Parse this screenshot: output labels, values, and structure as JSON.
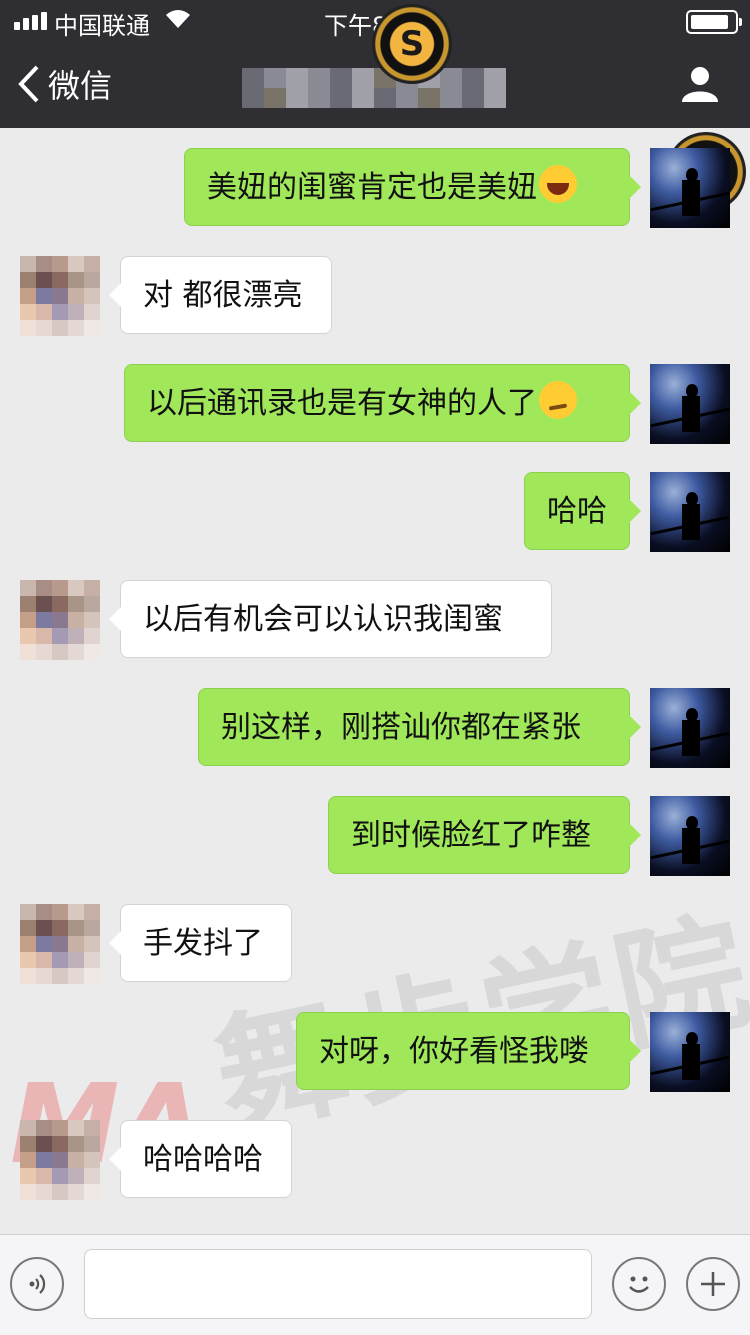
{
  "status_bar": {
    "carrier": "中国联通",
    "time": "下午8:21"
  },
  "nav": {
    "back_label": "微信"
  },
  "logo_text": "S",
  "messages": [
    {
      "from": "me",
      "text": "美妞的闺蜜肯定也是美妞",
      "emoji": "laugh-cry-emoji"
    },
    {
      "from": "other",
      "text": "对 都很漂亮"
    },
    {
      "from": "me",
      "text": "以后通讯录也是有女神的人了",
      "emoji": "smirk-emoji"
    },
    {
      "from": "me",
      "text": "哈哈"
    },
    {
      "from": "other",
      "text": "以后有机会可以认识我闺蜜"
    },
    {
      "from": "me",
      "text": "别这样，刚搭讪你都在紧张"
    },
    {
      "from": "me",
      "text": "到时候脸红了咋整"
    },
    {
      "from": "other",
      "text": "手发抖了"
    },
    {
      "from": "me",
      "text": "对呀，你好看怪我喽"
    },
    {
      "from": "other",
      "text": "哈哈哈哈"
    }
  ],
  "watermark": {
    "text": "舞步学院",
    "logo": "MA"
  },
  "colors": {
    "header_bg": "#2e2e33",
    "my_bubble": "#a0e75a",
    "other_bubble": "#ffffff",
    "chat_bg": "#ebebeb"
  },
  "input_bar": {
    "voice_icon": "voice-icon",
    "emoji_icon": "emoji-icon",
    "plus_icon": "plus-icon"
  }
}
